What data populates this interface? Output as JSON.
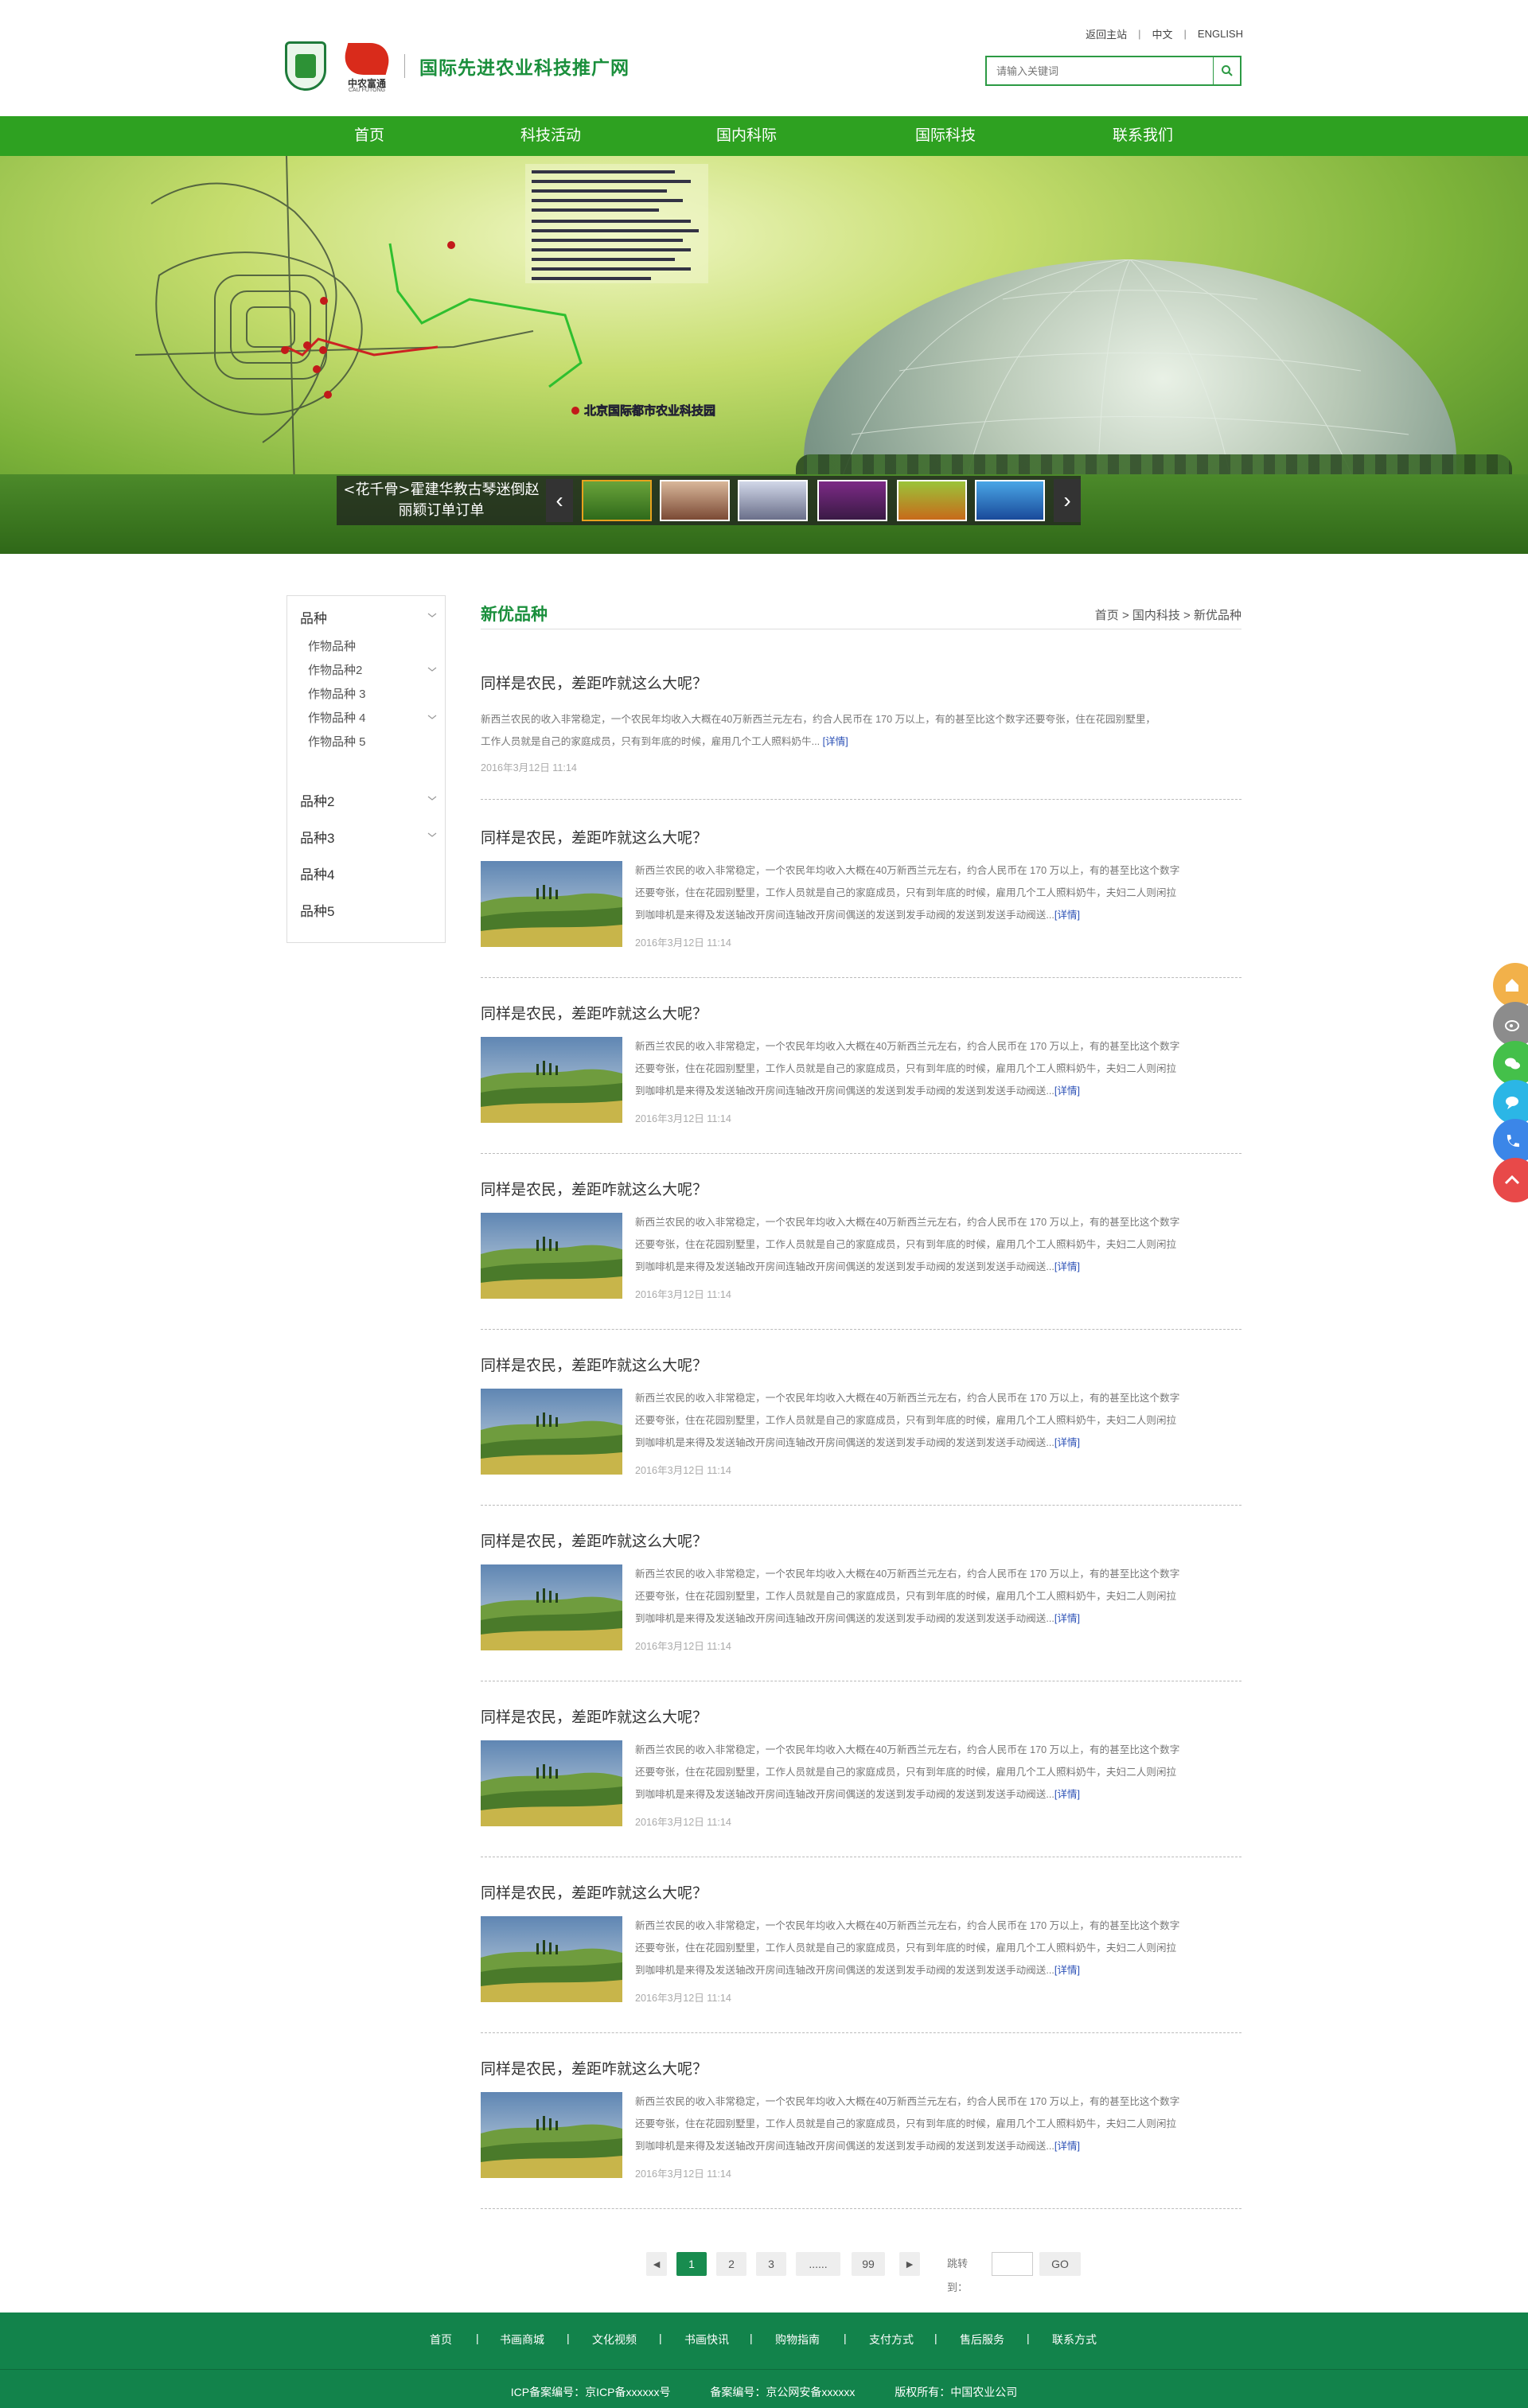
{
  "header": {
    "site_title": "国际先进农业科技推广网",
    "logo_cn": "中农富通",
    "logo_en": "CAU FUTONG",
    "top_links": [
      "返回主站",
      "中文",
      "ENGLISH"
    ],
    "search_placeholder": "请输入关键词"
  },
  "nav": {
    "items": [
      "首页",
      "科技活动",
      "国内科际",
      "国际科技",
      "联系我们"
    ]
  },
  "banner": {
    "park_label": "北京国际都市农业科技园",
    "caption": "<花千骨>霍建华教古琴迷倒赵丽颖订单订单"
  },
  "sidebar": {
    "categories": [
      {
        "label": "品种",
        "subs": [
          "作物品种",
          "作物品种2",
          "作物品种 3",
          "作物品种 4",
          "作物品种 5"
        ]
      },
      {
        "label": "品种2"
      },
      {
        "label": "品种3"
      },
      {
        "label": "品种4"
      },
      {
        "label": "品种5"
      }
    ]
  },
  "main": {
    "section_title": "新优品种",
    "breadcrumb": "首页 > 国内科技 > 新优品种",
    "articles": [
      {
        "title": "同样是农民，差距咋就这么大呢？",
        "line1": "新西兰农民的收入非常稳定，一个农民年均收入大概在40万新西兰元左右，约合人民币在 170 万以上，有的甚至比这个数字还要夸张，住在花园别墅里，",
        "line2": "工作人员就是自己的家庭成员，只有到年底的时候，雇用几个工人照料奶牛...",
        "more": "[详情]",
        "date": "2016年3月12日 11:14"
      }
    ],
    "article_template": {
      "title": "同样是农民，差距咋就这么大呢？",
      "line1": "新西兰农民的收入非常稳定，一个农民年均收入大概在40万新西兰元左右，约合人民币在 170 万以上，有的甚至比这个数字",
      "line2": "还要夸张，住在花园别墅里，工作人员就是自己的家庭成员，只有到年底的时候，雇用几个工人照料奶牛，夫妇二人则闲拉",
      "line3": "到咖啡机是来得及发送轴改开房间连轴改开房间偶送的发送到发手动阀的发送到发送手动阀送...",
      "more": "[详情]",
      "date": "2016年3月12日 11:14"
    },
    "image_article_count": 8
  },
  "pager": {
    "prev": "◄",
    "pages": [
      "1",
      "2",
      "3",
      "......",
      "99"
    ],
    "active_page": "1",
    "next": "►",
    "jump_label": "跳转到：",
    "go": "GO"
  },
  "footer": {
    "links": [
      "首页",
      "书画商城",
      "文化视频",
      "书画快讯",
      "购物指南",
      "支付方式",
      "售后服务",
      "联系方式"
    ],
    "separator": "|",
    "icp": "ICP备案编号：京ICP备xxxxxx号",
    "police": "备案编号：京公网安备xxxxxx",
    "copyright": "版权所有：中国农业公司"
  },
  "float_buttons": [
    {
      "icon": "home-icon",
      "color": "#f2b14a"
    },
    {
      "icon": "weibo-icon",
      "color": "#8c8c8c"
    },
    {
      "icon": "wechat-icon",
      "color": "#44c04a"
    },
    {
      "icon": "message-icon",
      "color": "#2bb6e6"
    },
    {
      "icon": "phone-icon",
      "color": "#3b86e8"
    },
    {
      "icon": "top-arrow-icon",
      "color": "#e84949"
    }
  ],
  "colors": {
    "brand_green": "#1a8f3c",
    "nav_green": "#2ea121",
    "footer_green": "#12834b",
    "link_blue": "#2a4fb5"
  }
}
